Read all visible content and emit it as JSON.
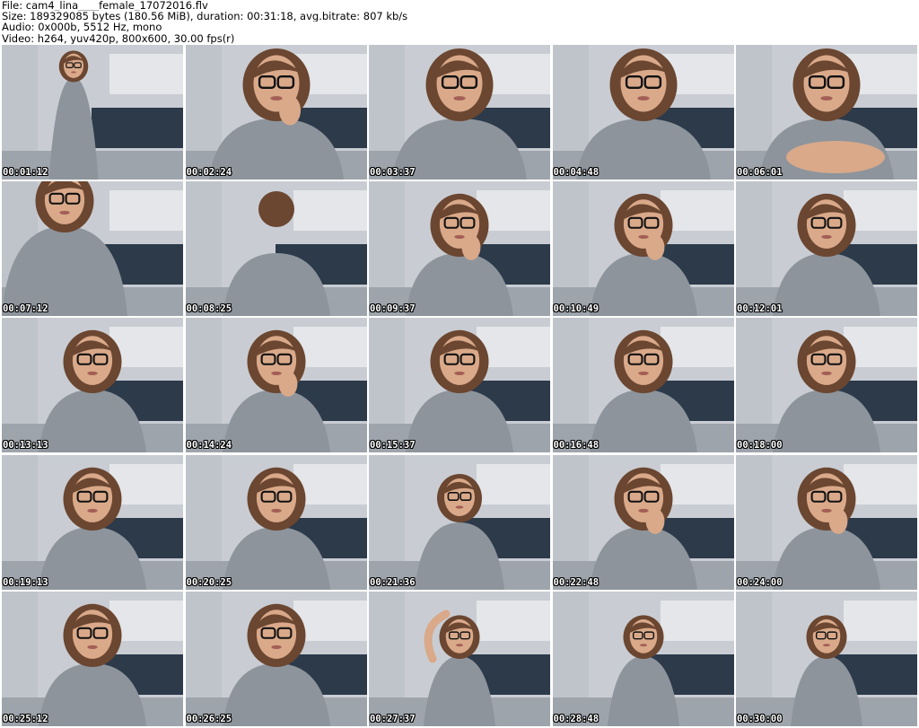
{
  "header": {
    "file_line": "File: cam4_lina____female_17072016.flv",
    "size_line": "Size: 189329085 bytes (180.56 MiB), duration: 00:31:18, avg.bitrate: 807 kb/s",
    "audio_line": "Audio: 0x000b, 5512 Hz, mono",
    "video_line": "Video: h264, yuv420p, 800x600, 30.00 fps(r)"
  },
  "thumbnails": [
    {
      "time": "00:01:12",
      "scene": "far"
    },
    {
      "time": "00:02:24",
      "scene": "close-hands"
    },
    {
      "time": "00:03:37",
      "scene": "close"
    },
    {
      "time": "00:04:48",
      "scene": "close"
    },
    {
      "time": "00:06:01",
      "scene": "close-arms"
    },
    {
      "time": "00:07:12",
      "scene": "lean"
    },
    {
      "time": "00:08:25",
      "scene": "back"
    },
    {
      "time": "00:09:37",
      "scene": "mid-hand"
    },
    {
      "time": "00:10:49",
      "scene": "mid-hand"
    },
    {
      "time": "00:12:01",
      "scene": "mid"
    },
    {
      "time": "00:13:13",
      "scene": "mid"
    },
    {
      "time": "00:14:24",
      "scene": "mid-hand"
    },
    {
      "time": "00:15:37",
      "scene": "mid"
    },
    {
      "time": "00:16:48",
      "scene": "mid"
    },
    {
      "time": "00:18:00",
      "scene": "mid"
    },
    {
      "time": "00:19:13",
      "scene": "mid"
    },
    {
      "time": "00:20:25",
      "scene": "mid"
    },
    {
      "time": "00:21:36",
      "scene": "mid-small"
    },
    {
      "time": "00:22:48",
      "scene": "mid-hand"
    },
    {
      "time": "00:24:00",
      "scene": "mid-hand"
    },
    {
      "time": "00:25:12",
      "scene": "mid"
    },
    {
      "time": "00:26:25",
      "scene": "mid"
    },
    {
      "time": "00:27:37",
      "scene": "standing-arm"
    },
    {
      "time": "00:28:48",
      "scene": "standing"
    },
    {
      "time": "00:30:00",
      "scene": "standing"
    }
  ],
  "colors": {
    "wall": "#c9cdd3",
    "tile": "#2c3a4a",
    "cabinet": "#e4e6e9",
    "shirt": "#8d949c",
    "hair": "#6b4630",
    "skin": "#d9a98a",
    "glasses": "#111111"
  }
}
